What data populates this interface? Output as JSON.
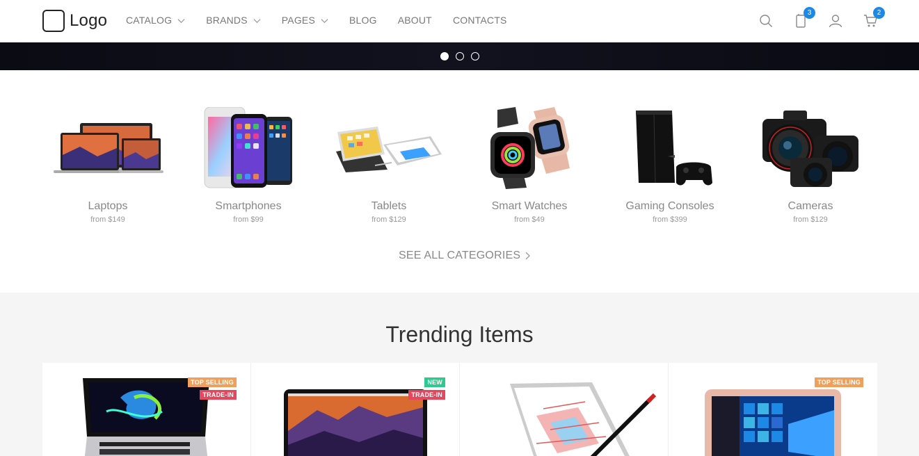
{
  "brand": {
    "logo_text": "Logo"
  },
  "nav": [
    {
      "label": "CATALOG",
      "has_dropdown": true
    },
    {
      "label": "BRANDS",
      "has_dropdown": true
    },
    {
      "label": "PAGES",
      "has_dropdown": true
    },
    {
      "label": "BLOG",
      "has_dropdown": false
    },
    {
      "label": "ABOUT",
      "has_dropdown": false
    },
    {
      "label": "CONTACTS",
      "has_dropdown": false
    }
  ],
  "tools": {
    "search_icon": "search-icon",
    "compare_icon": "compare-icon",
    "compare_count": "3",
    "account_icon": "user-icon",
    "cart_icon": "cart-icon",
    "cart_count": "2"
  },
  "slider": {
    "slides": 3,
    "active_index": 0
  },
  "categories": [
    {
      "name": "Laptops",
      "price": "from $149"
    },
    {
      "name": "Smartphones",
      "price": "from $99"
    },
    {
      "name": "Tablets",
      "price": "from $129"
    },
    {
      "name": "Smart Watches",
      "price": "from $49"
    },
    {
      "name": "Gaming Consoles",
      "price": "from $399"
    },
    {
      "name": "Cameras",
      "price": "from $129"
    }
  ],
  "see_all": {
    "label": "SEE ALL CATEGORIES"
  },
  "trending": {
    "title": "Trending Items",
    "products": [
      {
        "tags": [
          {
            "label": "TOP SELLING",
            "color": "#f0a05a"
          },
          {
            "label": "TRADE-IN",
            "color": "#e5475f"
          }
        ]
      },
      {
        "tags": [
          {
            "label": "NEW",
            "color": "#2ec98e"
          },
          {
            "label": "TRADE-IN",
            "color": "#e5475f"
          }
        ]
      },
      {
        "tags": []
      },
      {
        "tags": [
          {
            "label": "TOP SELLING",
            "color": "#f0a05a"
          }
        ]
      }
    ]
  },
  "colors": {
    "accent": "#1e88e5",
    "hero_bg": "#0d0d18"
  }
}
